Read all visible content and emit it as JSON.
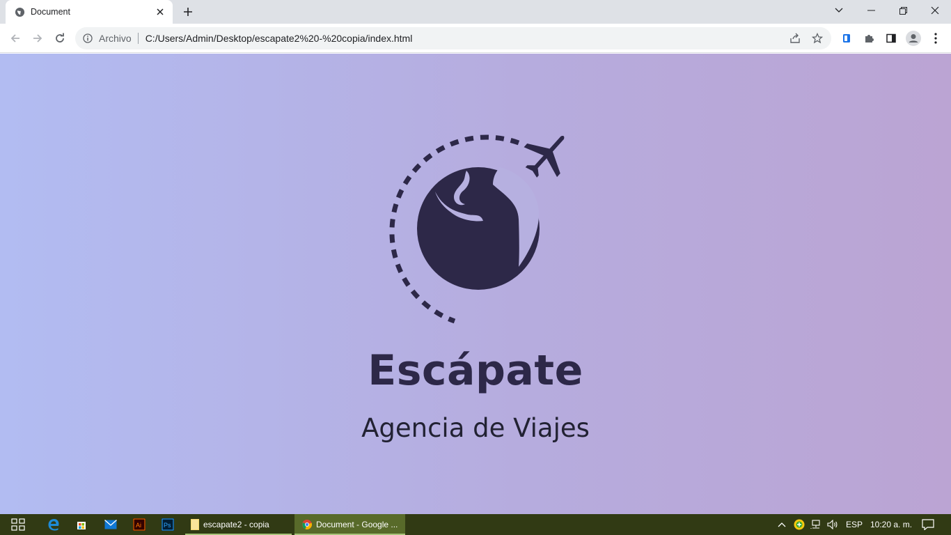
{
  "browser": {
    "tab_title": "Document",
    "address_chip": "Archivo",
    "url": "C:/Users/Admin/Desktop/escapate2%20-%20copia/index.html"
  },
  "page": {
    "brand": "Escápate",
    "subtitle": "Agencia de Viajes",
    "colors": {
      "ink": "#2d2848",
      "bg_start": "#b2bcf2",
      "bg_end": "#bba4d3"
    }
  },
  "taskbar": {
    "apps": [
      {
        "label": "escapate2 - copia",
        "icon": "folder-icon"
      },
      {
        "label": "Document - Google ...",
        "icon": "chrome-icon",
        "active": true
      }
    ],
    "language": "ESP",
    "time": "10:20 a. m."
  }
}
